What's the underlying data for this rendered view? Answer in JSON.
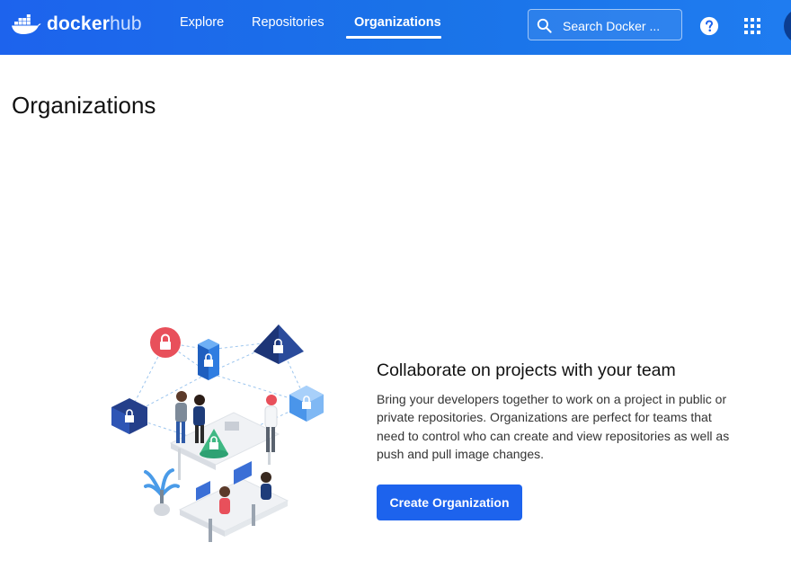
{
  "brand": {
    "name_part1": "docker",
    "name_part2": "hub"
  },
  "nav": {
    "items": [
      {
        "label": "Explore",
        "active": false
      },
      {
        "label": "Repositories",
        "active": false
      },
      {
        "label": "Organizations",
        "active": true
      }
    ]
  },
  "search": {
    "placeholder": "Search Docker ..."
  },
  "icons": {
    "logo": "docker-whale-icon",
    "search": "search-icon",
    "help": "help-icon",
    "apps": "apps-grid-icon",
    "avatar": "user-avatar"
  },
  "page": {
    "title": "Organizations"
  },
  "cta": {
    "heading": "Collaborate on projects with your team",
    "description": "Bring your developers together to work on a project in public or private repositories. Organizations are perfect for teams that need to control who can create and view repositories as well as push and pull image changes.",
    "button_label": "Create Organization"
  },
  "colors": {
    "header_blue": "#1d63ed",
    "button_blue": "#1d63ed",
    "text_dark": "#111111"
  }
}
